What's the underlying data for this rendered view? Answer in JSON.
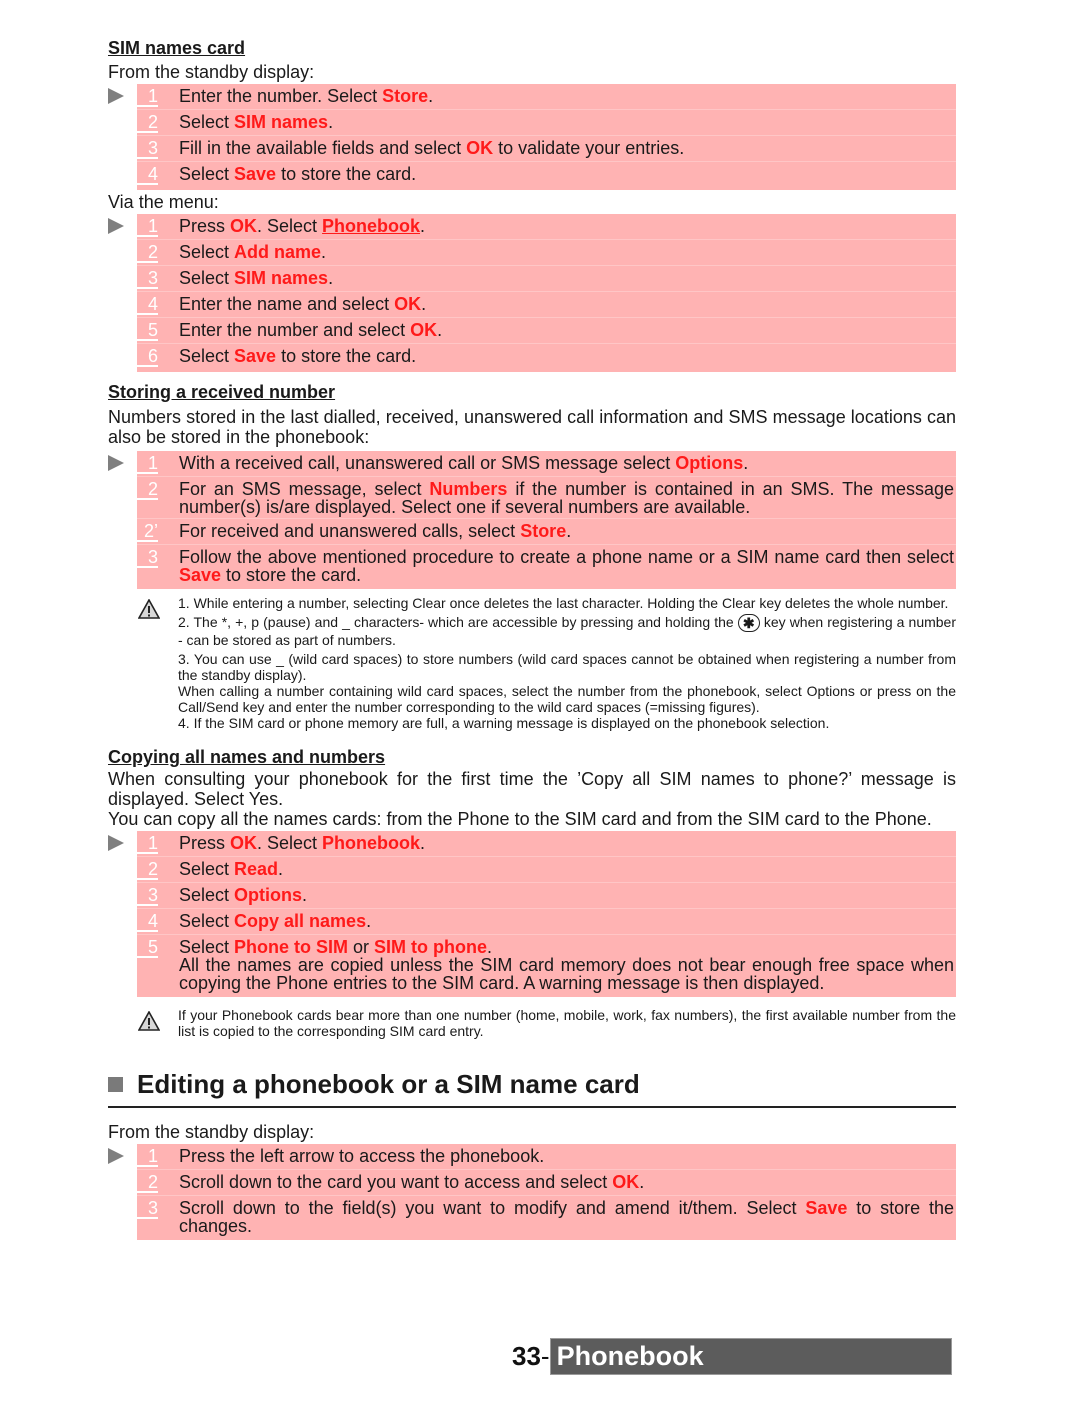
{
  "sim_names_card": {
    "heading": "SIM names card",
    "from_standby_label": "From the standby display:",
    "standby_steps": [
      {
        "num": "1",
        "parts": [
          {
            "t": "Enter the number. Select "
          },
          {
            "t": "Store",
            "h": true
          },
          {
            "t": "."
          }
        ]
      },
      {
        "num": "2",
        "parts": [
          {
            "t": "Select "
          },
          {
            "t": "SIM names",
            "h": true
          },
          {
            "t": "."
          }
        ]
      },
      {
        "num": "3",
        "parts": [
          {
            "t": "Fill in the available fields and select "
          },
          {
            "t": "OK",
            "h": true
          },
          {
            "t": " to validate your entries."
          }
        ]
      },
      {
        "num": "4",
        "parts": [
          {
            "t": "Select "
          },
          {
            "t": "Save",
            "h": true
          },
          {
            "t": " to store the card."
          }
        ]
      }
    ],
    "via_menu_label": "Via the menu:",
    "menu_steps": [
      {
        "num": "1",
        "parts": [
          {
            "t": "Press "
          },
          {
            "t": "OK",
            "h": true
          },
          {
            "t": ". Select "
          },
          {
            "t": "Phonebook",
            "h": true,
            "link": true
          },
          {
            "t": "."
          }
        ]
      },
      {
        "num": "2",
        "parts": [
          {
            "t": "Select "
          },
          {
            "t": "Add name",
            "h": true
          },
          {
            "t": "."
          }
        ]
      },
      {
        "num": "3",
        "parts": [
          {
            "t": "Select "
          },
          {
            "t": "SIM names",
            "h": true
          },
          {
            "t": "."
          }
        ]
      },
      {
        "num": "4",
        "parts": [
          {
            "t": "Enter the name and select "
          },
          {
            "t": "OK",
            "h": true
          },
          {
            "t": "."
          }
        ]
      },
      {
        "num": "5",
        "parts": [
          {
            "t": "Enter the number and select "
          },
          {
            "t": "OK",
            "h": true
          },
          {
            "t": "."
          }
        ]
      },
      {
        "num": "6",
        "parts": [
          {
            "t": "Select "
          },
          {
            "t": "Save",
            "h": true
          },
          {
            "t": " to store the card."
          }
        ]
      }
    ]
  },
  "storing_received": {
    "heading": "Storing a received number",
    "intro": "Numbers stored in the last dialled, received, unanswered call information and SMS message locations can also be stored in the phonebook:",
    "steps": [
      {
        "num": "1",
        "parts": [
          {
            "t": "With a received call, unanswered call or SMS message select "
          },
          {
            "t": "Options",
            "h": true
          },
          {
            "t": "."
          }
        ]
      },
      {
        "num": "2",
        "parts": [
          {
            "t": "For an SMS message, select "
          },
          {
            "t": "Numbers",
            "h": true
          },
          {
            "t": " if the number is contained in an SMS. The message number(s) is/are displayed. Select one if several numbers are available."
          }
        ]
      },
      {
        "num": "2’",
        "parts": [
          {
            "t": "For received and unanswered calls, select "
          },
          {
            "t": "Store",
            "h": true
          },
          {
            "t": "."
          }
        ]
      },
      {
        "num": "3",
        "parts": [
          {
            "t": "Follow the above mentioned procedure to create a phone name or a SIM name card then select "
          },
          {
            "t": "Save",
            "h": true
          },
          {
            "t": " to store the card."
          }
        ]
      }
    ],
    "notes": {
      "n1": "1. While entering a number, selecting Clear once deletes the last character. Holding the Clear key deletes the whole number.",
      "n2_before": "2. The *, +, p (pause) and _ characters- which are accessible by pressing and holding the ",
      "n2_key": "✱",
      "n2_after": " key when registering a number - can be stored as part of numbers.",
      "n3": "3. You can use _ (wild card spaces) to store numbers (wild card spaces cannot be obtained when registering a number from the standby display).",
      "n3b": "When calling a number containing wild card spaces, select the number from the phonebook, select Options or press on the Call/Send key and enter the number corresponding to the wild card spaces (=missing figures).",
      "n4": "4. If the SIM card or phone memory are full, a warning message is displayed on the phonebook selection."
    }
  },
  "copying": {
    "heading": "Copying all names and numbers",
    "intro1": "When consulting your phonebook for the first time the ’Copy all SIM names to phone?’ message is displayed. Select Yes.",
    "intro2": "You can copy all the names cards: from the Phone to the SIM card and from the SIM card to the Phone.",
    "steps": [
      {
        "num": "1",
        "parts": [
          {
            "t": "Press "
          },
          {
            "t": "OK",
            "h": true
          },
          {
            "t": ". Select "
          },
          {
            "t": "Phonebook",
            "h": true
          },
          {
            "t": "."
          }
        ]
      },
      {
        "num": "2",
        "parts": [
          {
            "t": "Select "
          },
          {
            "t": "Read",
            "h": true
          },
          {
            "t": "."
          }
        ]
      },
      {
        "num": "3",
        "parts": [
          {
            "t": "Select "
          },
          {
            "t": "Options",
            "h": true
          },
          {
            "t": "."
          }
        ]
      },
      {
        "num": "4",
        "parts": [
          {
            "t": "Select "
          },
          {
            "t": "Copy all names",
            "h": true
          },
          {
            "t": "."
          }
        ]
      },
      {
        "num": "5",
        "parts": [
          {
            "t": "Select "
          },
          {
            "t": "Phone to SIM",
            "h": true
          },
          {
            "t": " or "
          },
          {
            "t": "SIM to phone",
            "h": true
          },
          {
            "t": ".\nAll the names are copied unless the SIM card memory does not bear enough free space when copying the Phone entries to the SIM card. A warning message is then displayed."
          }
        ]
      }
    ],
    "note": "If your Phonebook cards bear more than one number (home, mobile, work, fax numbers), the first available number from the list is copied to the corresponding SIM card entry."
  },
  "editing": {
    "title": "Editing a phonebook or a SIM name card",
    "from_standby_label": "From the standby display:",
    "steps": [
      {
        "num": "1",
        "parts": [
          {
            "t": "Press the left arrow to access the phonebook."
          }
        ]
      },
      {
        "num": "2",
        "parts": [
          {
            "t": "Scroll down to the card you want to access and select "
          },
          {
            "t": "OK",
            "h": true
          },
          {
            "t": "."
          }
        ]
      },
      {
        "num": "3",
        "parts": [
          {
            "t": "Scroll down to the field(s) you want to modify and amend it/them. Select "
          },
          {
            "t": "Save",
            "h": true
          },
          {
            "t": " to store the changes."
          }
        ]
      }
    ]
  },
  "footer": {
    "page_number": "33",
    "separator": "-",
    "chapter": "Phonebook"
  },
  "colors": {
    "step_background": "#ffb3b3",
    "highlight": "#ff1a1a",
    "footer_bar": "#5c5c5c"
  },
  "icons": {
    "step_marker": "play-arrow-icon",
    "warning": "warning-triangle-icon",
    "star_key": "star-key-icon",
    "section_bullet": "square-bullet-icon"
  }
}
